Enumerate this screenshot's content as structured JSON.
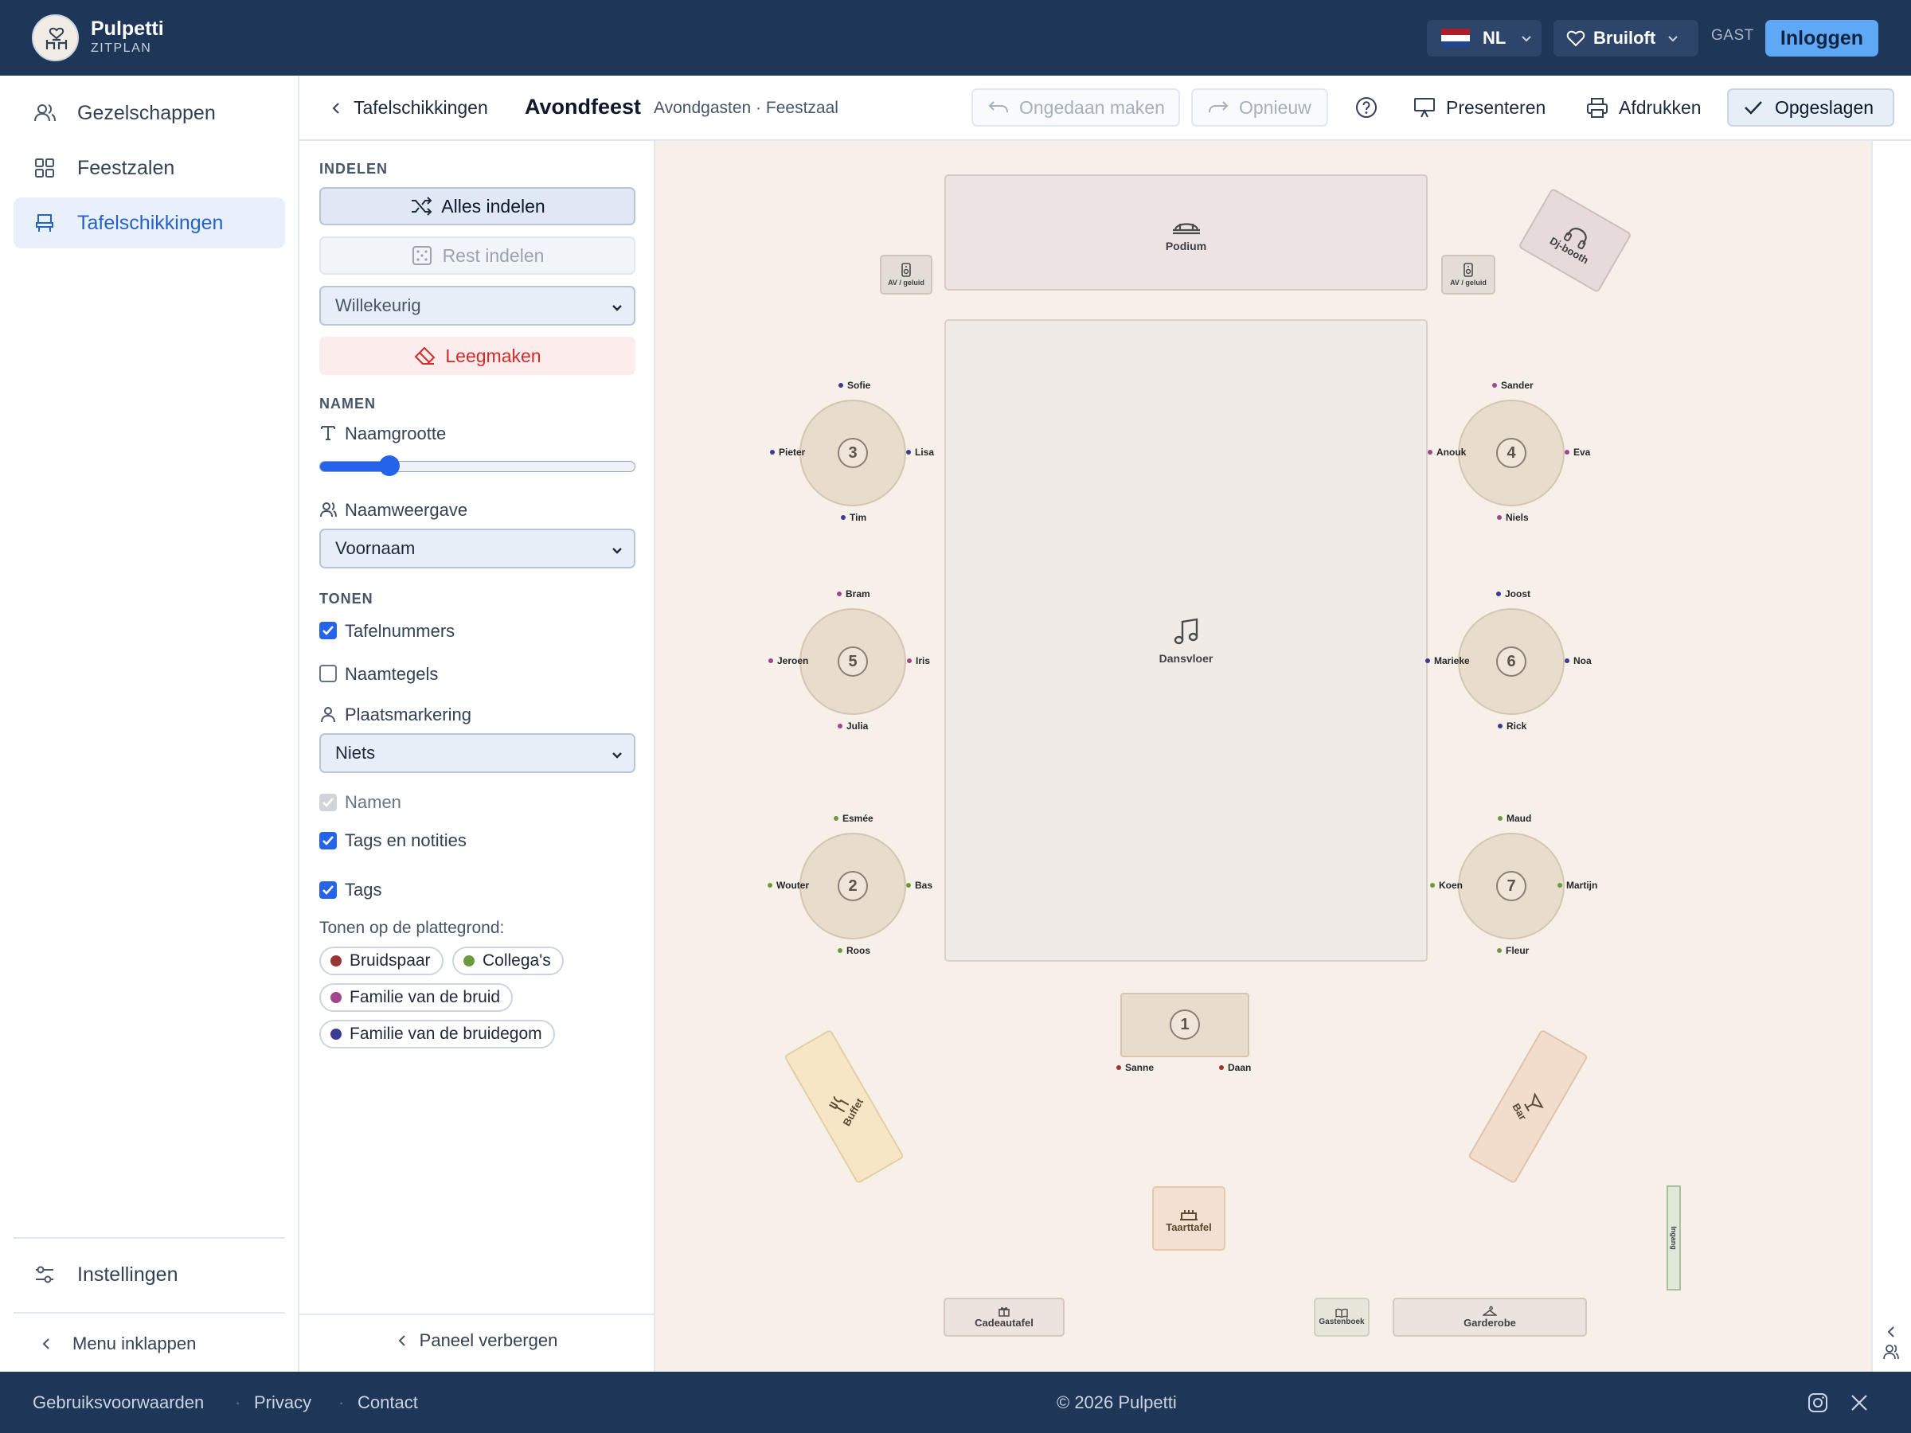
{
  "app": {
    "brand": "Pulpetti",
    "brand_sub": "ZITPLAN"
  },
  "topbar": {
    "lang": "NL",
    "project": "Bruiloft",
    "user_badge": "GAST",
    "login": "Inloggen",
    "flag_colors": [
      "#ae1c28",
      "#ffffff",
      "#21468b"
    ]
  },
  "sidebar": {
    "items": [
      {
        "label": "Gezelschappen",
        "icon": "users-icon"
      },
      {
        "label": "Feestzalen",
        "icon": "grid-icon"
      },
      {
        "label": "Tafelschikkingen",
        "icon": "seat-icon",
        "active": true
      }
    ],
    "settings": "Instellingen",
    "collapse": "Menu inklappen"
  },
  "header": {
    "back": "Tafelschikkingen",
    "title": "Avondfeest",
    "subtitle": "Avondgasten · Feestzaal",
    "undo": "Ongedaan maken",
    "redo": "Opnieuw",
    "present": "Presenteren",
    "print": "Afdrukken",
    "saved": "Opgeslagen"
  },
  "panel": {
    "sec_indelen": "INDELEN",
    "assign_all": "Alles indelen",
    "assign_rest": "Rest indelen",
    "mode_select": "Willekeurig",
    "clear": "Leegmaken",
    "sec_namen": "NAMEN",
    "name_size": "Naamgrootte",
    "name_size_value": 0.2,
    "name_display": "Naamweergave",
    "name_display_select": "Voornaam",
    "sec_tonen": "TONEN",
    "chk_table_numbers": "Tafelnummers",
    "chk_name_tiles": "Naamtegels",
    "seat_marking": "Plaatsmarkering",
    "seat_marking_select": "Niets",
    "chk_names": "Namen",
    "chk_tags_notes": "Tags en notities",
    "chk_tags": "Tags",
    "show_on_map": "Tonen op de plattegrond:",
    "tags": [
      {
        "label": "Bruidspaar",
        "color": "#9b3434"
      },
      {
        "label": "Collega's",
        "color": "#6a9a3a"
      },
      {
        "label": "Familie van de bruid",
        "color": "#a0478c"
      },
      {
        "label": "Familie van de bruidegom",
        "color": "#3b3b94"
      }
    ],
    "hide_panel": "Paneel verbergen"
  },
  "floor": {
    "podium": "Podium",
    "dj": "Dj-booth",
    "av_left": "AV / geluid",
    "av_right": "AV / geluid",
    "dancefloor": "Dansvloer",
    "buffet": "Buffet",
    "bar": "Bar",
    "cake": "Taarttafel",
    "gifts": "Cadeautafel",
    "guestbook": "Gastenboek",
    "wardrobe": "Garderobe",
    "entrance": "Ingang",
    "tables": [
      {
        "num": "3",
        "guests": {
          "top": "Sofie",
          "left": "Pieter",
          "right": "Lisa",
          "bottom": "Tim"
        }
      },
      {
        "num": "4",
        "guests": {
          "top": "Sander",
          "left": "Anouk",
          "right": "Eva",
          "bottom": "Niels"
        }
      },
      {
        "num": "5",
        "guests": {
          "top": "Bram",
          "left": "Jeroen",
          "right": "Iris",
          "bottom": "Julia"
        }
      },
      {
        "num": "6",
        "guests": {
          "top": "Joost",
          "left": "Marieke",
          "right": "Noa",
          "bottom": "Rick"
        }
      },
      {
        "num": "2",
        "guests": {
          "top": "Esmée",
          "left": "Wouter",
          "right": "Bas",
          "bottom": "Roos"
        }
      },
      {
        "num": "7",
        "guests": {
          "top": "Maud",
          "left": "Koen",
          "right": "Martijn",
          "bottom": "Fleur"
        }
      }
    ],
    "head_table": {
      "num": "1",
      "guest_left": "Sanne",
      "guest_right": "Daan"
    }
  },
  "footer": {
    "terms": "Gebruiksvoorwaarden",
    "privacy": "Privacy",
    "contact": "Contact",
    "copyright": "© 2026 Pulpetti"
  }
}
